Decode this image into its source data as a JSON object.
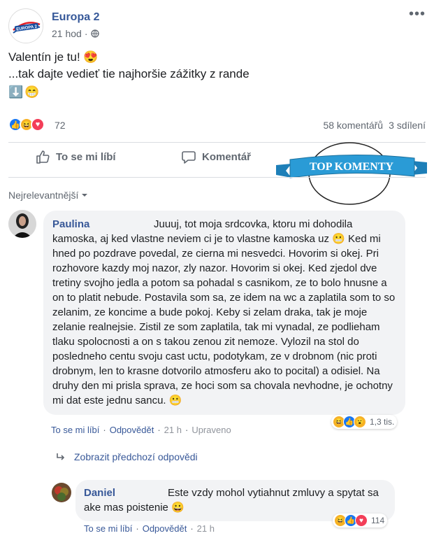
{
  "post": {
    "page_name": "Europa 2",
    "logo_text": "EUROPA 2",
    "time": "21 hod",
    "privacy_icon": "globe-icon",
    "line1": "Valentín je tu! 😍",
    "line2": "...tak dajte vedieť tie najhoršie zážitky z rande",
    "emoji_line": [
      "⬇️",
      "😁"
    ],
    "reaction_count": "72",
    "comments_count": "58 komentářů",
    "shares_count": "3 sdílení"
  },
  "actions": {
    "like": "To se mi líbí",
    "comment": "Komentář"
  },
  "badge": {
    "text": "TOP KOMENTY"
  },
  "sort": {
    "label": "Nejrelevantnější"
  },
  "comments": [
    {
      "name": "Paulina",
      "text": "Juuuj, tot moja srdcovka, ktoru mi dohodila kamoska, aj ked vlastne neviem ci je to vlastne kamoska uz 😬 Ked mi hned po pozdrave povedal, ze cierna mi nesvedci. Hovorim si okej. Pri rozhovore kazdy moj nazor, zly nazor. Hovorim si okej. Ked zjedol dve tretiny svojho jedla a potom sa pohadal s casnikom, ze to bolo hnusne a on to platit nebude. Postavila som sa, ze idem na wc a zaplatila som to so zelanim, ze koncime a bude pokoj. Keby si zelam draka, tak je moje zelanie realnejsie. Zistil ze som zaplatila, tak mi vynadal, ze podlieham tlaku spolocnosti a on s takou zenou zit nemoze. Vylozil na stol do posledneho centu svoju cast uctu, podotykam, ze v drobnom (nic proti drobnym, len to krasne dotvorilo atmosferu ako to pocital) a odisiel. Na druhy den mi prisla sprava, ze hoci som sa chovala nevhodne, je ochotny mi dat este jednu sancu. 😬",
      "like": "To se mi líbí",
      "reply": "Odpovědět",
      "time": "21 h",
      "edited": "Upraveno",
      "reactions": "1,3 tis."
    },
    {
      "name": "Daniel",
      "text": "Este vzdy mohol vytiahnut zmluvy a spytat sa ake mas poistenie 😀",
      "like": "To se mi líbí",
      "reply": "Odpovědět",
      "time": "21 h",
      "reactions": "114"
    }
  ],
  "previous_replies": "Zobrazit předchozí odpovědi",
  "colors": {
    "like_blue": "#1877f2",
    "love_red": "#f33e58",
    "haha_yellow": "#f7b125",
    "link_blue": "#385898"
  }
}
